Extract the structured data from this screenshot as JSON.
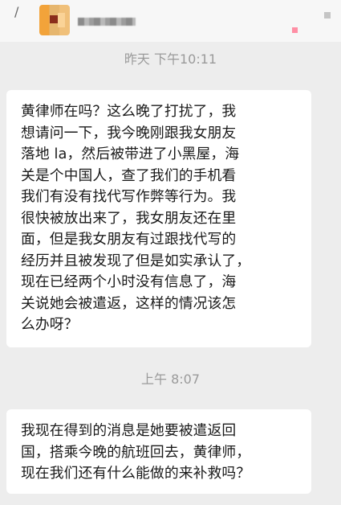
{
  "header": {
    "back": "/"
  },
  "timestamps": {
    "yesterday": "昨天 下午10:11",
    "morning": "上午 8:07"
  },
  "messages": [
    {
      "lines": [
        "黄律师在吗？这么晚了打扰了，我",
        "想请问一下，我今晚刚跟我女朋友",
        "落地 la，然后被带进了小黑屋，海",
        "关是个中国人，查了我们的手机看",
        "我们有没有找代写作弊等行为。我",
        "很快被放出来了，我女朋友还在里",
        "面，但是我女朋友有过跟找代写的",
        "经历并且被发现了但是如实承认了，",
        "现在已经两个小时没有信息了，海",
        "关说她会被遣返，这样的情况该怎",
        "么办呀？"
      ]
    },
    {
      "lines": [
        "我现在得到的消息是她要被遣返回",
        "国，搭乘今晚的航班回去，黄律师，",
        "现在我们还有什么能做的来补救吗？"
      ]
    }
  ]
}
